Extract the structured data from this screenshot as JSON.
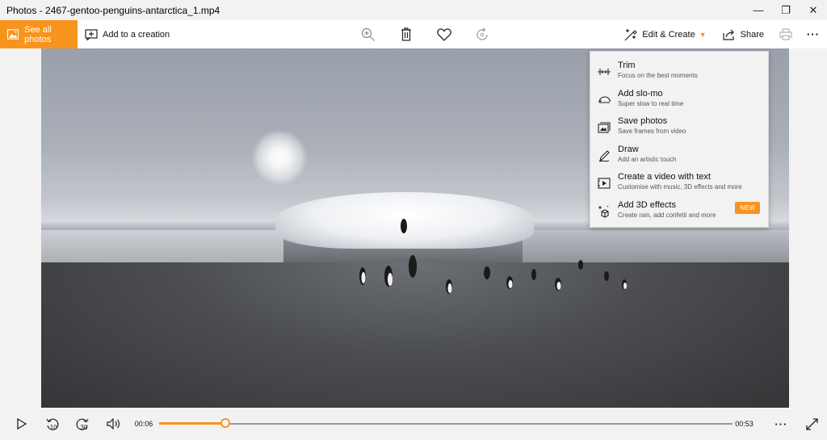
{
  "window": {
    "title": "Photos - 2467-gentoo-penguins-antarctica_1.mp4",
    "minimize_icon": "—",
    "restore_icon": "❐",
    "close_icon": "✕"
  },
  "toolbar": {
    "see_all_label": "See all photos",
    "add_creation_label": "Add to a creation",
    "edit_create_label": "Edit & Create",
    "share_label": "Share",
    "more_label": "···"
  },
  "edit_menu": {
    "items": [
      {
        "title": "Trim",
        "subtitle": "Focus on the best moments",
        "icon": "trim-icon"
      },
      {
        "title": "Add slo-mo",
        "subtitle": "Super slow to real time",
        "icon": "slomo-icon"
      },
      {
        "title": "Save photos",
        "subtitle": "Save frames from video",
        "icon": "save-photos-icon"
      },
      {
        "title": "Draw",
        "subtitle": "Add an artistic touch",
        "icon": "draw-icon"
      },
      {
        "title": "Create a video with text",
        "subtitle": "Customise with music, 3D effects and more",
        "icon": "video-text-icon"
      },
      {
        "title": "Add 3D effects",
        "subtitle": "Create rain, add confetti and more",
        "icon": "3d-effects-icon",
        "badge": "NEW"
      }
    ]
  },
  "playback": {
    "current_time": "00:06",
    "total_time": "00:53",
    "progress": 0.116,
    "rewind_label": "10",
    "forward_label": "30",
    "more_label": "···"
  },
  "colors": {
    "accent": "#f7941d"
  }
}
